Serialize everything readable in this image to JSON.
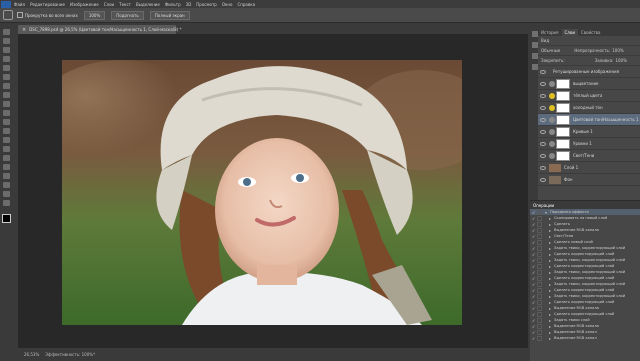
{
  "menu": {
    "items": [
      "Файл",
      "Редактирование",
      "Изображение",
      "Слои",
      "Текст",
      "Выделение",
      "Фильтр",
      "3D",
      "Просмотр",
      "Окно",
      "Справка"
    ]
  },
  "options_bar": {
    "checkbox_label": "Прокрутка во всех окнах",
    "zoom_value": "100%",
    "fit_button": "Подогнать",
    "fill_button": "Полный экран"
  },
  "document": {
    "tab_title": "DSC_7898.psd @ 26,5% (Цветовой тон/Насыщенность 1, Слой-маска/8) *",
    "status_zoom": "26,53%",
    "status_info": "Эффективность: 100%*"
  },
  "layers_panel": {
    "tabs": [
      "История",
      "Слои",
      "Свойства"
    ],
    "active_tab": "Слои",
    "filter_label": "Вид",
    "blend_mode": "Обычные",
    "opacity_label": "Непрозрачность:",
    "opacity_value": "100%",
    "lock_label": "Закрепить:",
    "fill_label": "Заливка:",
    "fill_value": "100%",
    "layers": [
      {
        "name": "Ретушированные изображения",
        "type": "group"
      },
      {
        "name": "выцветание",
        "type": "adjustment"
      },
      {
        "name": "тёплый цвета",
        "type": "adjustment"
      },
      {
        "name": "холодный тон",
        "type": "adjustment"
      },
      {
        "name": "Цветовой тон/Насыщенность 1",
        "type": "adjustment",
        "selected": true
      },
      {
        "name": "Кривые 1",
        "type": "adjustment"
      },
      {
        "name": "Уровни 1",
        "type": "adjustment"
      },
      {
        "name": "Свет/Тени",
        "type": "adjustment"
      },
      {
        "name": "Слой 1",
        "type": "pixel"
      },
      {
        "name": "Фон",
        "type": "pixel"
      }
    ]
  },
  "actions_panel": {
    "title": "Операции",
    "items": [
      {
        "label": "Переделка эффекта",
        "group": true
      },
      {
        "label": "Скопировать на новый слой"
      },
      {
        "label": "Сделать"
      },
      {
        "label": "Выделение RGB канала"
      },
      {
        "label": "Свет/Тени"
      },
      {
        "label": "Сделать новый слой"
      },
      {
        "label": "Задать твики, корректирующий слой"
      },
      {
        "label": "Сделать корректирующий слой"
      },
      {
        "label": "Задать твики, корректирующий слой"
      },
      {
        "label": "Сделать корректирующий слой"
      },
      {
        "label": "Задать твики, корректирующий слой"
      },
      {
        "label": "Сделать корректирующий слой"
      },
      {
        "label": "Задать твики, корректирующий слой"
      },
      {
        "label": "Сделать корректирующий слой"
      },
      {
        "label": "Задать твики, корректирующий слой"
      },
      {
        "label": "Сделать корректирующий слой"
      },
      {
        "label": "Выделение RGB канала"
      },
      {
        "label": "Сделать корректирующий слой"
      },
      {
        "label": "Задать твики слой"
      },
      {
        "label": "Выделение RGB канала"
      },
      {
        "label": "Выделение RGB канал"
      },
      {
        "label": "Выделение RGB канал"
      }
    ]
  },
  "colors": {
    "accent": "#5d6b7e",
    "photoshop_blue": "#2a5fa6"
  }
}
